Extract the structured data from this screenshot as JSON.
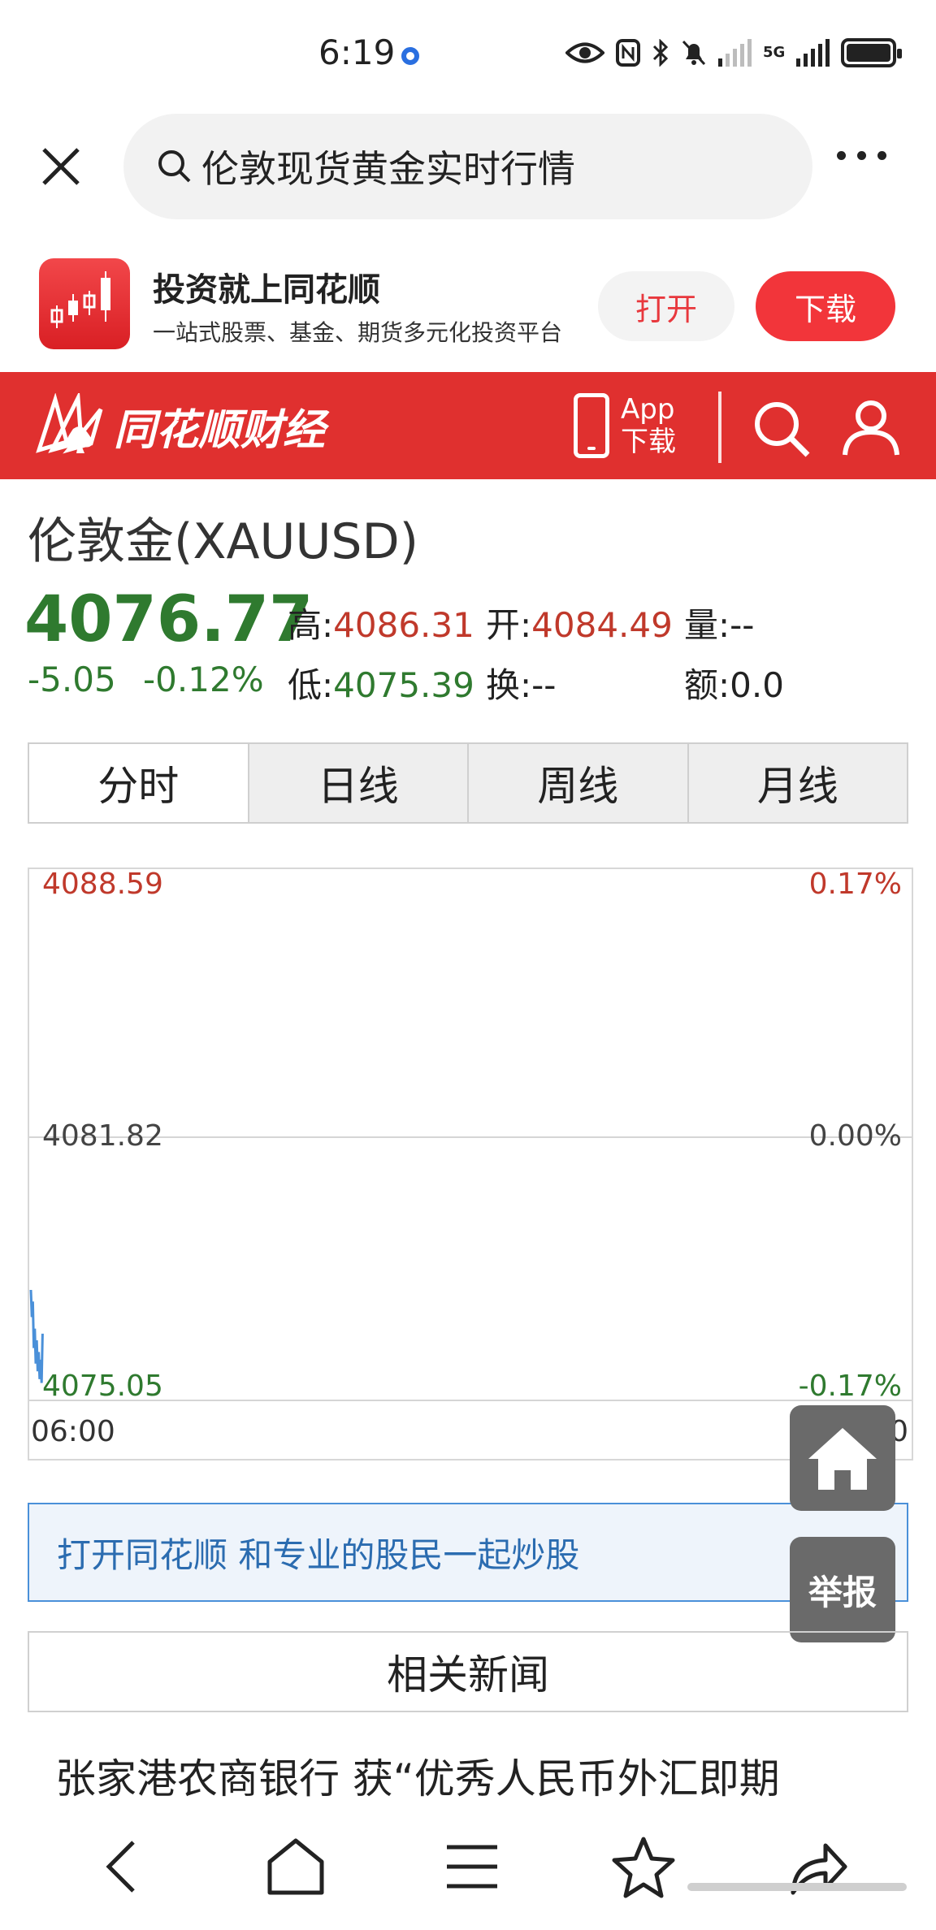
{
  "status_bar": {
    "time": "6:19",
    "network": "5G",
    "icons": [
      "eye-icon",
      "nfc-icon",
      "bluetooth-icon",
      "mute-bell-icon",
      "signal-icon",
      "signal-icon",
      "battery-icon"
    ]
  },
  "search": {
    "query": "伦敦现货黄金实时行情"
  },
  "app_banner": {
    "name": "投资就上同花顺",
    "description": "一站式股票、基金、期货多元化投资平台",
    "open_label": "打开",
    "download_label": "下载"
  },
  "site_header": {
    "logo_text": "同花顺财经",
    "app_label": "App",
    "download_label": "下载",
    "brand_color": "#e0302f"
  },
  "quote": {
    "name": "伦敦金(XAUUSD)",
    "price": "4076.77",
    "change": "-5.05",
    "change_pct": "-0.12%",
    "high_label": "高:",
    "high": "4086.31",
    "open_label": "开:",
    "open": "4084.49",
    "volume_label": "量:",
    "volume": "--",
    "low_label": "低:",
    "low": "4075.39",
    "turnover_label": "换:",
    "turnover": "--",
    "amount_label": "额:",
    "amount": "0.0",
    "up_color": "#c0392b",
    "down_color": "#2f7a2f"
  },
  "tabs": [
    {
      "label": "分时",
      "active": true
    },
    {
      "label": "日线",
      "active": false
    },
    {
      "label": "周线",
      "active": false
    },
    {
      "label": "月线",
      "active": false
    }
  ],
  "chart_data": {
    "type": "line",
    "y_max_label": "4088.59",
    "y_mid_label": "4081.82",
    "y_min_label": "4075.05",
    "pct_max_label": "0.17%",
    "pct_mid_label": "0.00%",
    "pct_min_label": "-0.17%",
    "x_start_label": "06:00",
    "x_end_label": "05:00",
    "ylim": [
      4075.05,
      4088.59
    ],
    "series": [
      {
        "values": [
          4077.9,
          4077.2,
          4077.6,
          4076.4,
          4076.9,
          4076.0,
          4076.6,
          4075.8,
          4076.3,
          4075.6,
          4076.1,
          4075.5,
          4076.77
        ]
      }
    ],
    "line_color": "#4a90d9"
  },
  "floating": {
    "report_label": "举报"
  },
  "promo": {
    "text": "打开同花顺 和专业的股民一起炒股"
  },
  "news": {
    "heading": "相关新闻",
    "items": [
      "张家港农商银行 获“优秀人民币外汇即期"
    ]
  }
}
